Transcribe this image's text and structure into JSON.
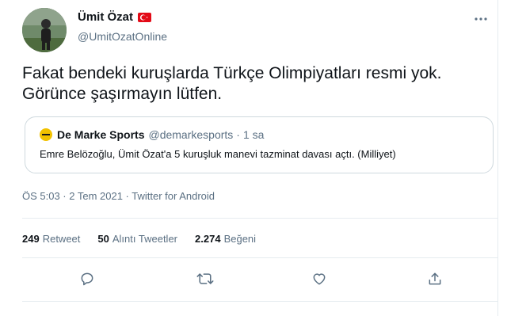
{
  "author": {
    "display_name": "Ümit Özat",
    "handle": "@UmitOzatOnline"
  },
  "tweet_text": "Fakat bendeki kuruşlarda Türkçe Olimpiyatları resmi yok. Görünce şaşırmayın lütfen.",
  "quoted": {
    "name": "De Marke Sports",
    "handle": "@demarkesports",
    "separator": "·",
    "time": "1 sa",
    "text": "Emre Belözoğlu, Ümit Özat'a 5 kuruşluk manevi tazminat davası açtı. (Milliyet)"
  },
  "meta": "ÖS 5:03 · 2 Tem 2021 · Twitter for Android",
  "stats": {
    "retweets": {
      "count": "249",
      "label": "Retweet"
    },
    "quotes": {
      "count": "50",
      "label": "Alıntı Tweetler"
    },
    "likes": {
      "count": "2.274",
      "label": "Beğeni"
    }
  },
  "icons": {
    "more": "more-icon",
    "reply": "reply-icon",
    "retweet": "retweet-icon",
    "like": "like-icon",
    "share": "share-icon",
    "flag": "turkey-flag-icon"
  },
  "colors": {
    "secondary_text": "#5b7083",
    "border": "#cfd9de",
    "flag_red": "#e30a17",
    "quoted_avatar": "#f2c200"
  }
}
